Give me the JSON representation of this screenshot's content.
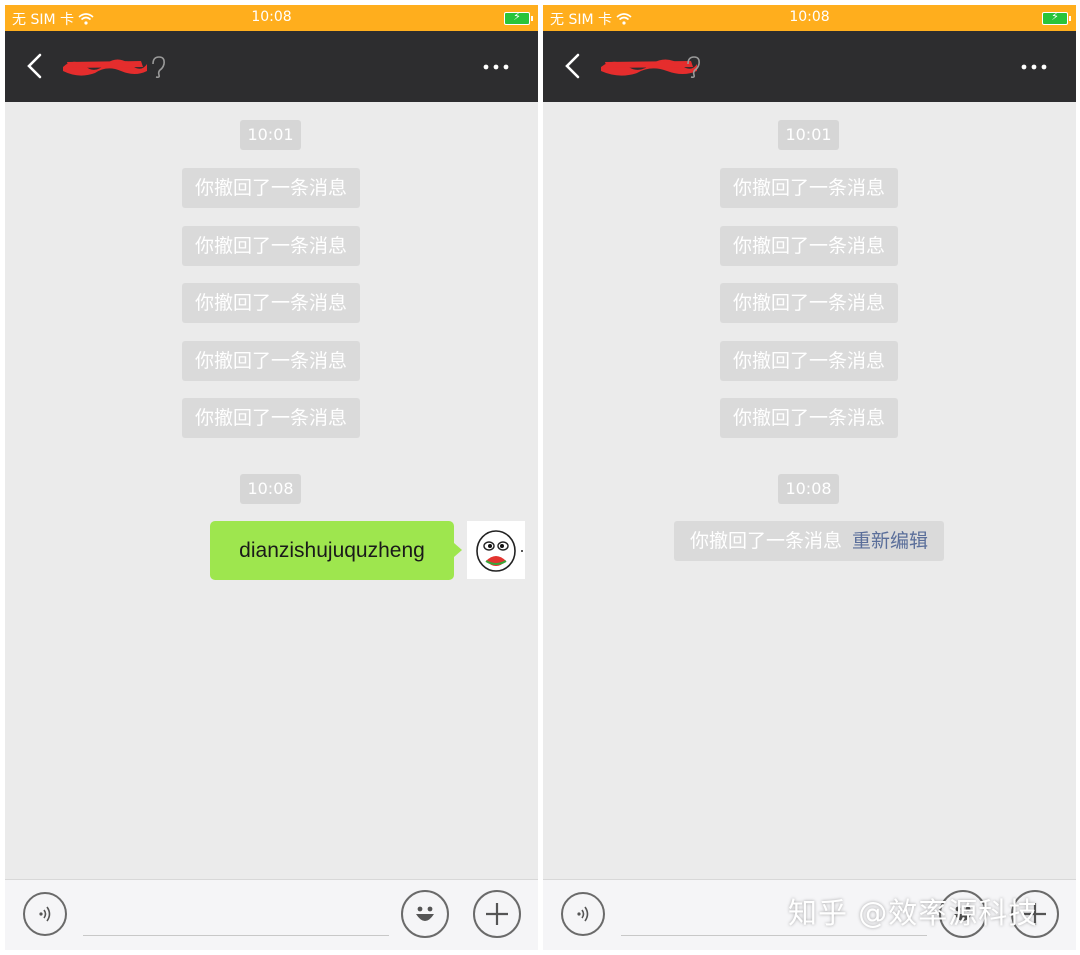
{
  "colors": {
    "status_bar": "#ffae1d",
    "title_bar": "#2d2d2f",
    "chat_bg": "#ebebeb",
    "bubble": "#9ee64e",
    "recall_link": "#5a6e9a"
  },
  "left_screen": {
    "status": {
      "carrier": "无 SIM 卡",
      "time": "10:08"
    },
    "header": {
      "back_icon": "chevron-left-icon",
      "more_icon": "more-dots-icon"
    },
    "messages": {
      "time1": "10:01",
      "recalled": [
        "你撤回了一条消息",
        "你撤回了一条消息",
        "你撤回了一条消息",
        "你撤回了一条消息",
        "你撤回了一条消息"
      ],
      "time2": "10:08",
      "sent_text": "dianzishujuquzheng"
    }
  },
  "right_screen": {
    "status": {
      "carrier": "无 SIM 卡",
      "time": "10:08"
    },
    "header": {
      "back_icon": "chevron-left-icon",
      "more_icon": "more-dots-icon"
    },
    "messages": {
      "time1": "10:01",
      "recalled": [
        "你撤回了一条消息",
        "你撤回了一条消息",
        "你撤回了一条消息",
        "你撤回了一条消息",
        "你撤回了一条消息"
      ],
      "time2": "10:08",
      "recall_notice": "你撤回了一条消息",
      "reedit_link": "重新编辑"
    }
  },
  "watermark": "知乎 @效率源科技"
}
